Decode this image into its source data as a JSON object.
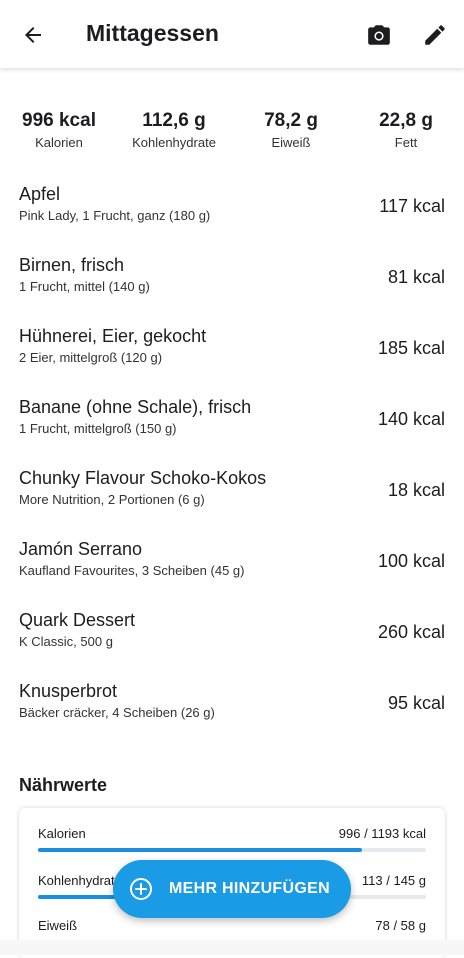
{
  "header": {
    "title": "Mittagessen"
  },
  "summary": [
    {
      "value": "996 kcal",
      "label": "Kalorien"
    },
    {
      "value": "112,6 g",
      "label": "Kohlenhydrate"
    },
    {
      "value": "78,2 g",
      "label": "Eiweiß"
    },
    {
      "value": "22,8 g",
      "label": "Fett"
    }
  ],
  "foods": [
    {
      "name": "Apfel",
      "detail": "Pink Lady, 1 Frucht, ganz (180 g)",
      "kcal": "117 kcal"
    },
    {
      "name": "Birnen, frisch",
      "detail": "1 Frucht, mittel (140 g)",
      "kcal": "81 kcal"
    },
    {
      "name": "Hühnerei, Eier, gekocht",
      "detail": "2 Eier, mittelgroß (120 g)",
      "kcal": "185 kcal"
    },
    {
      "name": "Banane (ohne Schale), frisch",
      "detail": "1 Frucht, mittelgroß (150 g)",
      "kcal": "140 kcal"
    },
    {
      "name": "Chunky Flavour Schoko-Kokos",
      "detail": "More Nutrition, 2 Portionen (6 g)",
      "kcal": "18 kcal"
    },
    {
      "name": "Jamón Serrano",
      "detail": "Kaufland Favourites, 3 Scheiben (45 g)",
      "kcal": "100 kcal"
    },
    {
      "name": "Quark Dessert",
      "detail": "K Classic, 500 g",
      "kcal": "260 kcal"
    },
    {
      "name": "Knusperbrot",
      "detail": "Bäcker cräcker, 4 Scheiben (26 g)",
      "kcal": "95 kcal"
    }
  ],
  "naehrwerte": {
    "title": "Nährwerte",
    "rows": [
      {
        "label": "Kalorien",
        "value": "996 / 1193 kcal",
        "fraction": 0.835
      },
      {
        "label": "Kohlenhydrate",
        "value": "113 / 145 g",
        "fraction": 0.78
      },
      {
        "label": "Eiweiß",
        "value": "78 / 58 g",
        "fraction": 1.0
      }
    ]
  },
  "fab": {
    "label": "MEHR HINZUFÜGEN"
  },
  "colors": {
    "accent": "#1a9be6",
    "bar": "#1a8fe0",
    "track": "#e6e9ee"
  },
  "icons": {
    "back": "arrow-left-icon",
    "camera": "camera-icon",
    "edit": "pencil-icon",
    "add": "plus-circle-icon"
  }
}
